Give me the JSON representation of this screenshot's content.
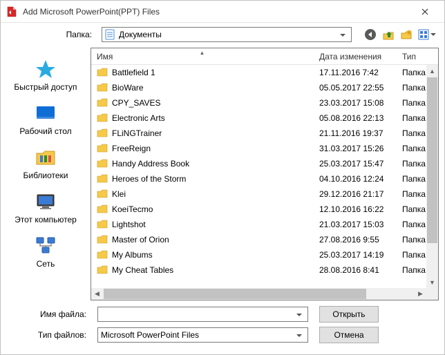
{
  "title": "Add Microsoft PowerPoint(PPT) Files",
  "folder_label": "Папка:",
  "current_folder": "Документы",
  "columns": {
    "name": "Имя",
    "date": "Дата изменения",
    "type": "Тип"
  },
  "places": {
    "quick_access": "Быстрый доступ",
    "desktop": "Рабочий стол",
    "libraries": "Библиотеки",
    "this_pc": "Этот компьютер",
    "network": "Сеть"
  },
  "rows": [
    {
      "name": "Battlefield 1",
      "date": "17.11.2016 7:42",
      "type": "Папка"
    },
    {
      "name": "BioWare",
      "date": "05.05.2017 22:55",
      "type": "Папка"
    },
    {
      "name": "CPY_SAVES",
      "date": "23.03.2017 15:08",
      "type": "Папка"
    },
    {
      "name": "Electronic Arts",
      "date": "05.08.2016 22:13",
      "type": "Папка"
    },
    {
      "name": "FLiNGTrainer",
      "date": "21.11.2016 19:37",
      "type": "Папка"
    },
    {
      "name": "FreeReign",
      "date": "31.03.2017 15:26",
      "type": "Папка"
    },
    {
      "name": "Handy Address Book",
      "date": "25.03.2017 15:47",
      "type": "Папка"
    },
    {
      "name": "Heroes of the Storm",
      "date": "04.10.2016 12:24",
      "type": "Папка"
    },
    {
      "name": "Klei",
      "date": "29.12.2016 21:17",
      "type": "Папка"
    },
    {
      "name": "KoeiTecmo",
      "date": "12.10.2016 16:22",
      "type": "Папка"
    },
    {
      "name": "Lightshot",
      "date": "21.03.2017 15:03",
      "type": "Папка"
    },
    {
      "name": "Master of Orion",
      "date": "27.08.2016 9:55",
      "type": "Папка"
    },
    {
      "name": "My Albums",
      "date": "25.03.2017 14:19",
      "type": "Папка"
    },
    {
      "name": "My Cheat Tables",
      "date": "28.08.2016 8:41",
      "type": "Папка"
    }
  ],
  "filename_label": "Имя файла:",
  "filetype_label": "Тип файлов:",
  "filetype_value": "Microsoft PowerPoint Files",
  "open_button": "Открыть",
  "cancel_button": "Отмена"
}
